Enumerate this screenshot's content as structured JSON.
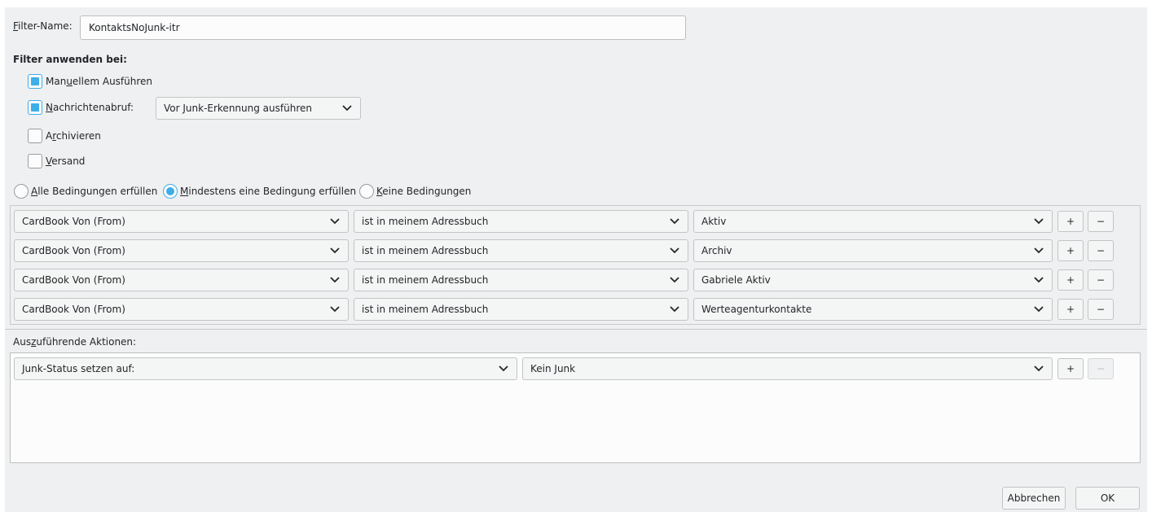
{
  "filter_name": {
    "label_accel": "F",
    "label_rest": "ilter-Name:",
    "value": "KontaktsNoJunk-itr"
  },
  "apply_when": {
    "heading": "Filter anwenden bei:",
    "manual": {
      "pre": "Man",
      "accel": "u",
      "post": "ellem Ausführen",
      "checked": true
    },
    "fetch": {
      "pre": "",
      "accel": "N",
      "post": "achrichtenabruf:",
      "checked": true,
      "option": "Vor Junk-Erkennung ausführen"
    },
    "archive": {
      "pre": "A",
      "accel": "r",
      "post": "chivieren",
      "checked": false
    },
    "send": {
      "pre": "",
      "accel": "V",
      "post": "ersand",
      "checked": false
    }
  },
  "match": {
    "all": {
      "accel": "A",
      "rest": "lle Bedingungen erfüllen",
      "checked": false
    },
    "any": {
      "accel": "M",
      "rest": "indestens eine Bedingung erfüllen",
      "checked": true
    },
    "none": {
      "accel": "K",
      "rest": "eine Bedingungen",
      "checked": false
    }
  },
  "conditions": [
    {
      "field": "CardBook Von (From)",
      "operator": "ist in meinem Adressbuch",
      "value": "Aktiv"
    },
    {
      "field": "CardBook Von (From)",
      "operator": "ist in meinem Adressbuch",
      "value": "Archiv"
    },
    {
      "field": "CardBook Von (From)",
      "operator": "ist in meinem Adressbuch",
      "value": "Gabriele Aktiv"
    },
    {
      "field": "CardBook Von (From)",
      "operator": "ist in meinem Adressbuch",
      "value": "Werteagenturkontakte"
    }
  ],
  "row_buttons": {
    "add": "+",
    "remove": "−"
  },
  "actions": {
    "heading_pre": "Aus",
    "heading_accel": "z",
    "heading_post": "uführende Aktionen:",
    "items": [
      {
        "action": "Junk-Status setzen auf:",
        "value": "Kein Junk"
      }
    ]
  },
  "footer": {
    "cancel": "Abbrechen",
    "ok": "OK"
  },
  "colors": {
    "accent": "#3daee9",
    "window_bg": "#eff0f1",
    "field_bg": "#fcfcfc"
  }
}
